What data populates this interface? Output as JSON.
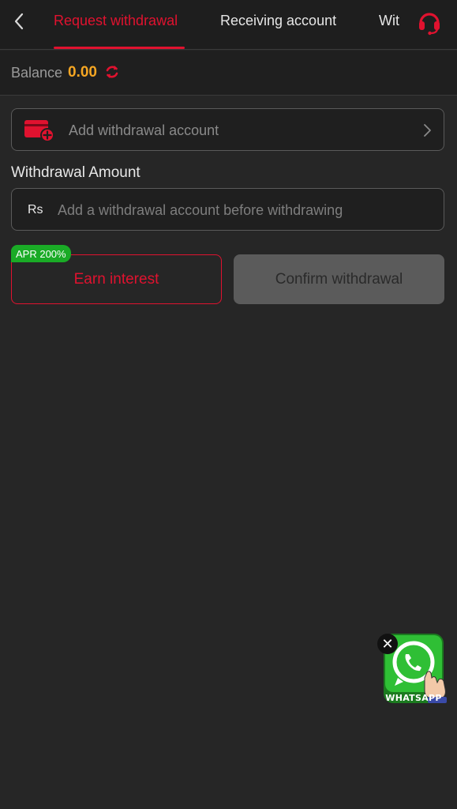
{
  "header": {
    "tabs": [
      {
        "label": "Request withdrawal",
        "active": true
      },
      {
        "label": "Receiving account",
        "active": false
      },
      {
        "label": "Wit",
        "active": false
      }
    ],
    "back_icon": "chevron-left-icon",
    "support_icon": "headset-icon"
  },
  "balance": {
    "label": "Balance",
    "value": "0.00"
  },
  "account": {
    "placeholder": "Add withdrawal account",
    "icon": "wallet-add-icon"
  },
  "amount": {
    "label": "Withdrawal Amount",
    "currency": "Rs",
    "placeholder": "Add a withdrawal account before withdrawing",
    "value": ""
  },
  "actions": {
    "earn_label": "Earn interest",
    "apr_badge": "APR 200%",
    "confirm_label": "Confirm withdrawal"
  },
  "whatsapp": {
    "label": "WHATSAPP",
    "close": "✕"
  },
  "colors": {
    "accent": "#e0122f",
    "balance": "#f5a623",
    "badge": "#1aab26",
    "background": "#262626"
  }
}
